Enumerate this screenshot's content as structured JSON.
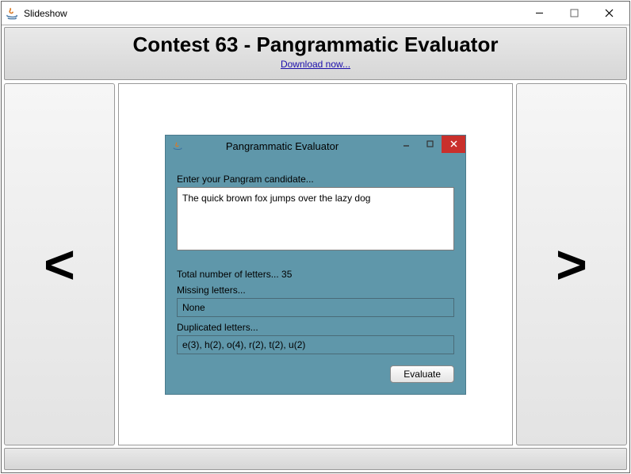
{
  "window": {
    "title": "Slideshow"
  },
  "header": {
    "title": "Contest 63 - Pangrammatic Evaluator",
    "download_link": "Download now..."
  },
  "nav": {
    "prev": "<",
    "next": ">"
  },
  "inner": {
    "title": "Pangrammatic Evaluator",
    "prompt_label": "Enter your Pangram candidate...",
    "input_value": "The quick brown fox jumps over the lazy dog",
    "total_label": "Total number of letters... 35",
    "missing_label": "Missing letters...",
    "missing_value": "None",
    "duplicated_label": "Duplicated letters...",
    "duplicated_value": "e(3), h(2), o(4), r(2), t(2), u(2)",
    "evaluate_label": "Evaluate"
  }
}
